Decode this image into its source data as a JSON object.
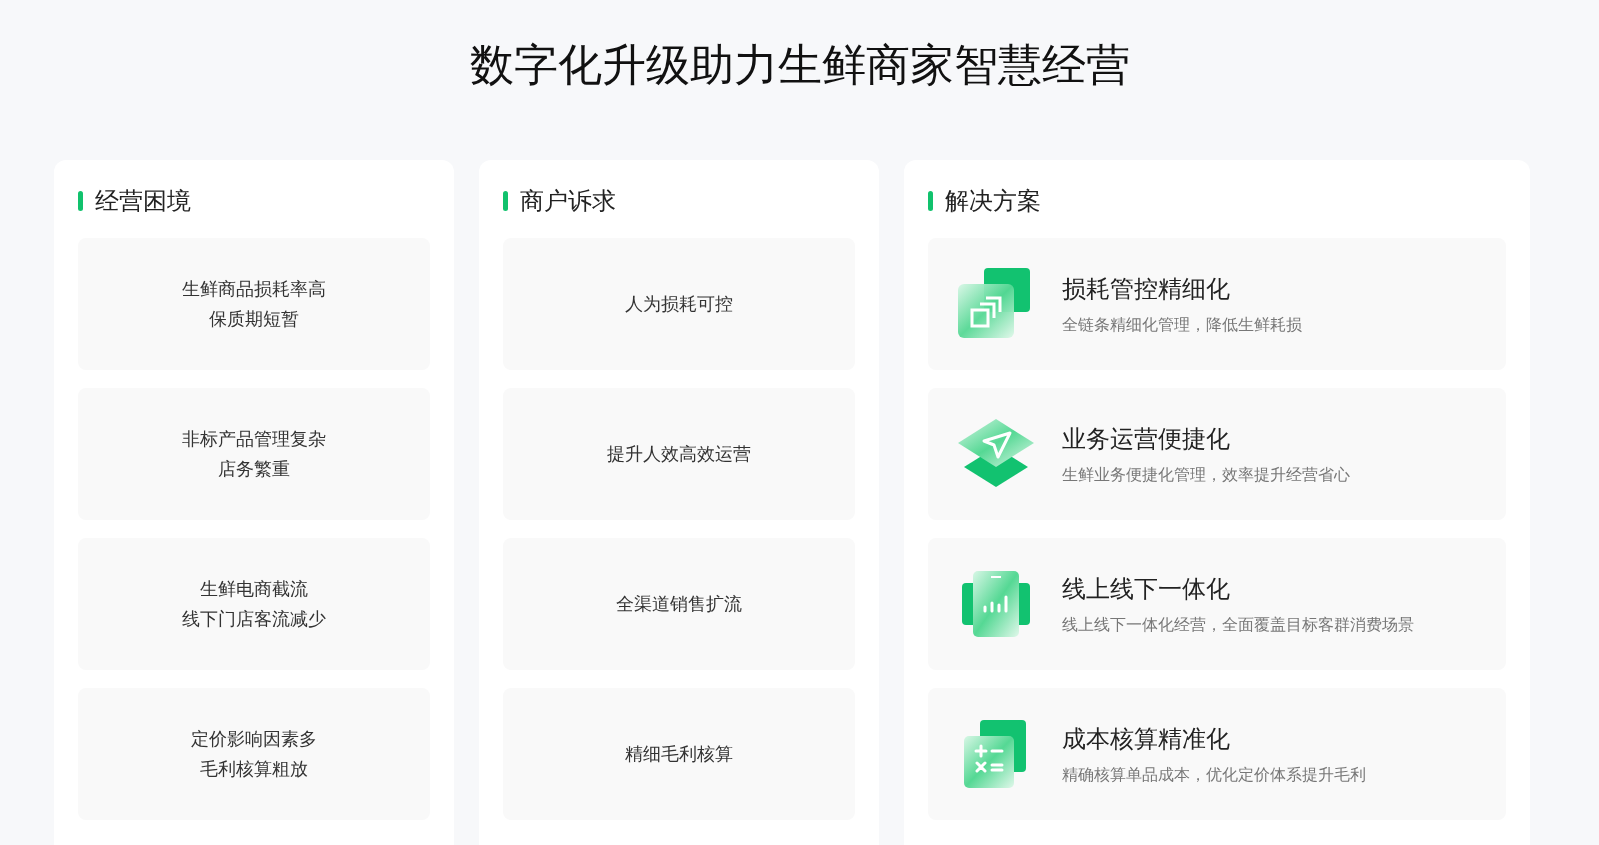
{
  "title": "数字化升级助力生鲜商家智慧经营",
  "columns": [
    {
      "heading": "经营困境",
      "items": [
        {
          "lines": [
            "生鲜商品损耗率高",
            "保质期短暂"
          ]
        },
        {
          "lines": [
            "非标产品管理复杂",
            "店务繁重"
          ]
        },
        {
          "lines": [
            "生鲜电商截流",
            "线下门店客流减少"
          ]
        },
        {
          "lines": [
            "定价影响因素多",
            "毛利核算粗放"
          ]
        }
      ]
    },
    {
      "heading": "商户诉求",
      "items": [
        {
          "lines": [
            "人为损耗可控"
          ]
        },
        {
          "lines": [
            "提升人效高效运营"
          ]
        },
        {
          "lines": [
            "全渠道销售扩流"
          ]
        },
        {
          "lines": [
            "精细毛利核算"
          ]
        }
      ]
    }
  ],
  "solutions": {
    "heading": "解决方案",
    "items": [
      {
        "title": "损耗管控精细化",
        "description": "全链条精细化管理，降低生鲜耗损"
      },
      {
        "title": "业务运营便捷化",
        "description": "生鲜业务便捷化管理，效率提升经营省心"
      },
      {
        "title": "线上线下一体化",
        "description": "线上线下一体化经营，全面覆盖目标客群消费场景"
      },
      {
        "title": "成本核算精准化",
        "description": "精确核算单品成本，优化定价体系提升毛利"
      }
    ]
  }
}
